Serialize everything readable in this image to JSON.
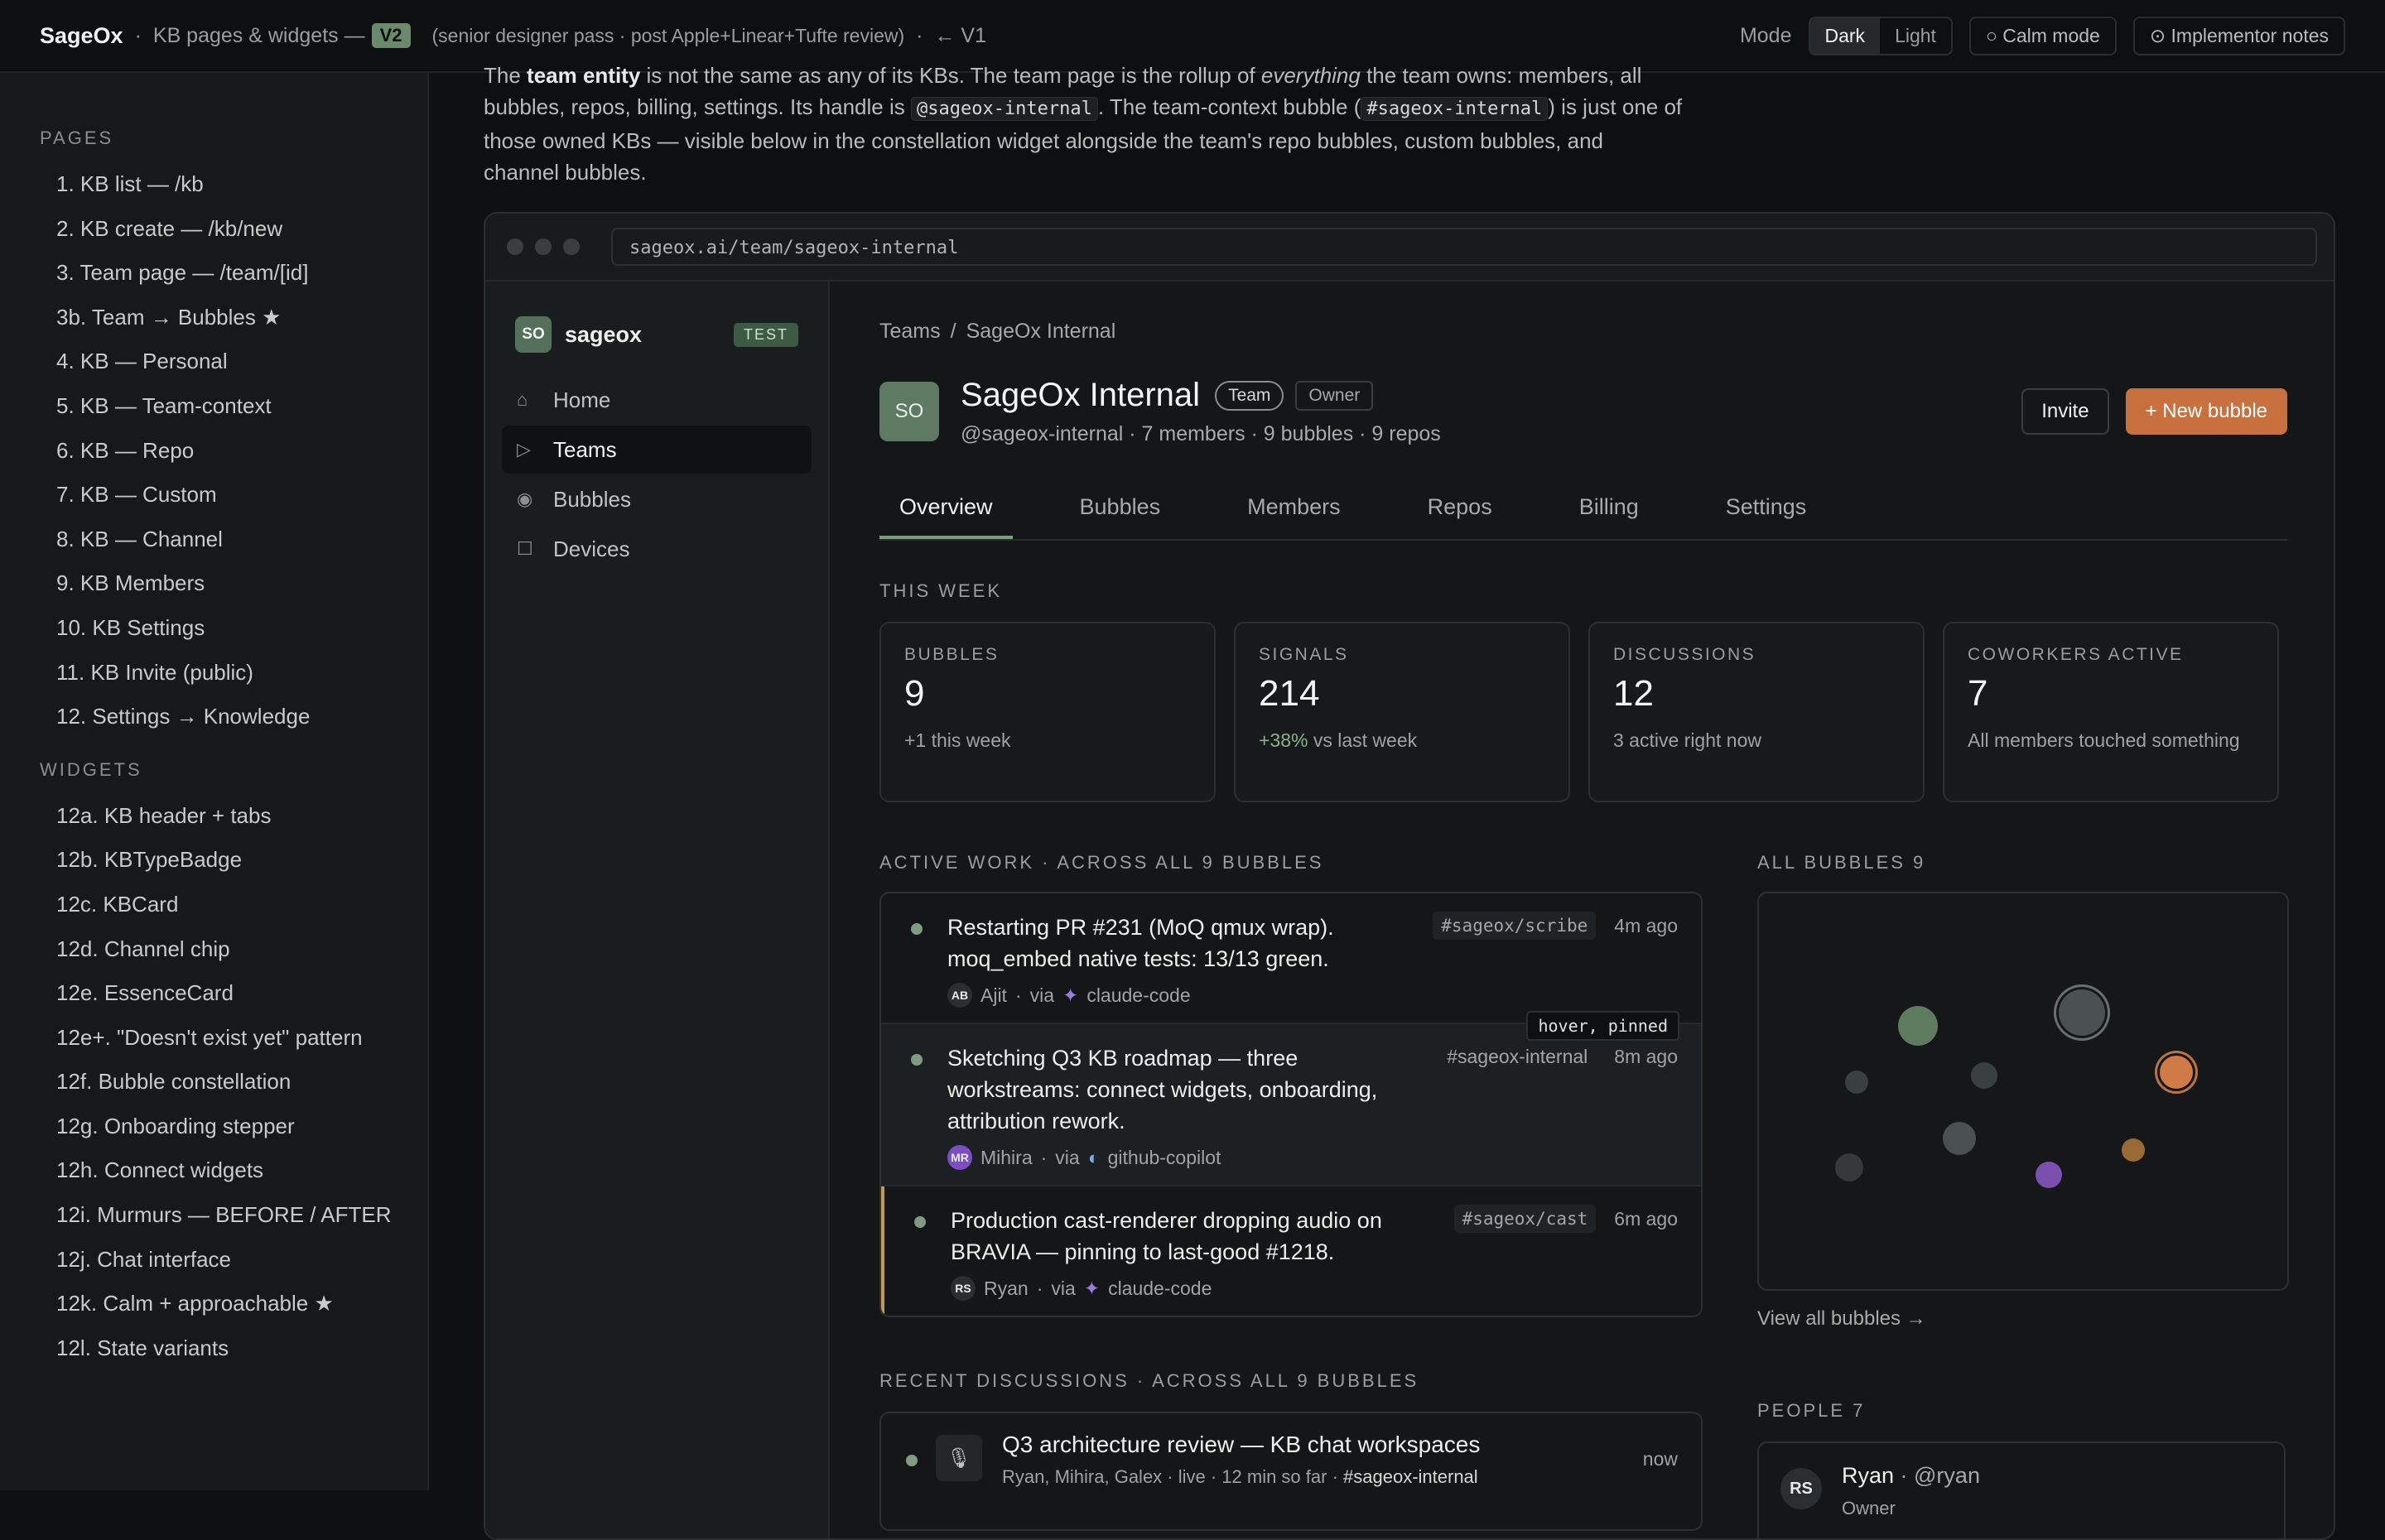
{
  "topbar": {
    "brand": "SageOx",
    "separator": "·",
    "section": "KB pages & widgets —",
    "version": "V2",
    "subtitle": "(senior designer pass · post Apple+Linear+Tufte review)",
    "back_link": "← V1",
    "mode_label": "Mode",
    "mode_dark": "Dark",
    "mode_light": "Light",
    "calm_mode": "Calm mode",
    "implementor_notes": "Implementor notes"
  },
  "leftnav": {
    "pages_heading": "PAGES",
    "pages": [
      "1. KB list — /kb",
      "2. KB create — /kb/new",
      "3. Team page — /team/[id]",
      "3b. Team → Bubbles ★",
      "4. KB — Personal",
      "5. KB — Team-context",
      "6. KB — Repo",
      "7. KB — Custom",
      "8. KB — Channel",
      "9. KB Members",
      "10. KB Settings",
      "11. KB Invite (public)",
      "12. Settings → Knowledge"
    ],
    "widgets_heading": "WIDGETS",
    "widgets": [
      "12a. KB header + tabs",
      "12b. KBTypeBadge",
      "12c. KBCard",
      "12d. Channel chip",
      "12e. EssenceCard",
      "12e+. \"Doesn't exist yet\" pattern",
      "12f. Bubble constellation",
      "12g. Onboarding stepper",
      "12h. Connect widgets",
      "12i. Murmurs — BEFORE / AFTER",
      "12j. Chat interface",
      "12k. Calm + approachable ★",
      "12l. State variants"
    ]
  },
  "intro": {
    "p1": "The ",
    "team_entity": "team entity",
    "p2": " is not the same as any of its KBs. The team page is the rollup of ",
    "everything": "everything",
    "p3": " the team owns: members, all bubbles, repos, billing, settings. Its handle is ",
    "handle": "@sageox-internal",
    "p4": ". The team-context bubble (",
    "bubble": "#sageox-internal",
    "p5": ") is just one of those owned KBs — visible below in the constellation widget alongside the team's repo bubbles, custom bubbles, and channel bubbles."
  },
  "browser": {
    "url": "sageox.ai/team/sageox-internal"
  },
  "app": {
    "workspace_initials": "SO",
    "workspace_name": "sageox",
    "env_badge": "TEST",
    "nav": [
      {
        "icon": "⌂",
        "label": "Home"
      },
      {
        "icon": "▷",
        "label": "Teams"
      },
      {
        "icon": "◉",
        "label": "Bubbles"
      },
      {
        "icon": "☐",
        "label": "Devices"
      }
    ]
  },
  "team": {
    "crumb_root": "Teams",
    "crumb_sep": "/",
    "crumb_current": "SageOx Internal",
    "initials": "SO",
    "name": "SageOx Internal",
    "type_pill": "Team",
    "role_tag": "Owner",
    "meta": "@sageox-internal · 7 members · 9 bubbles · 9 repos",
    "invite": "Invite",
    "new_bubble": "+ New bubble",
    "tabs": [
      "Overview",
      "Bubbles",
      "Members",
      "Repos",
      "Billing",
      "Settings"
    ]
  },
  "this_week": {
    "heading": "THIS WEEK",
    "stats": [
      {
        "label": "BUBBLES",
        "value": "9",
        "desc": "+1 this week",
        "desc_pos": ""
      },
      {
        "label": "SIGNALS",
        "value": "214",
        "desc_pos": "+38%",
        "desc": " vs last week"
      },
      {
        "label": "DISCUSSIONS",
        "value": "12",
        "desc": "3 active right now",
        "desc_pos": ""
      },
      {
        "label": "COWORKERS ACTIVE",
        "value": "7",
        "desc": "All members touched something",
        "desc_pos": ""
      }
    ]
  },
  "active_work": {
    "heading": "ACTIVE WORK · ACROSS ALL 9 BUBBLES",
    "tooltip": "hover, pinned",
    "via": "via",
    "dot": "·",
    "items": [
      {
        "text": "Restarting PR #231 (MoQ qmux wrap). moq_embed native tests: 13/13 green.",
        "chip": "#sageox/scribe",
        "time": "4m ago",
        "initials": "AB",
        "person": "Ajit",
        "agent_icon": "✦",
        "agent": "claude-code"
      },
      {
        "text": "Sketching Q3 KB roadmap — three workstreams: connect widgets, onboarding, attribution rework.",
        "chip": "#sageox-internal",
        "time": "8m ago",
        "initials": "MR",
        "person": "Mihira",
        "agent_icon": "◐",
        "agent": "github-copilot"
      },
      {
        "text": "Production cast-renderer dropping audio on BRAVIA — pinning to last-good #1218.",
        "chip": "#sageox/cast",
        "time": "6m ago",
        "initials": "RS",
        "person": "Ryan",
        "agent_icon": "✦",
        "agent": "claude-code"
      }
    ]
  },
  "all_bubbles": {
    "heading": "ALL BUBBLES 9",
    "view_all": "View all bubbles →",
    "colors": {
      "sage": "#6b8a6b",
      "orange": "#d07a45",
      "violet": "#8a5cc0",
      "amber": "#a8743a",
      "grey": "#464b4e"
    }
  },
  "recent": {
    "heading": "RECENT DISCUSSIONS · ACROSS ALL 9 BUBBLES",
    "icon": "🎙",
    "title": "Q3 architecture review — KB chat workspaces",
    "meta": "Ryan, Mihira, Galex · live · 12 min so far · ",
    "channel": "#sageox-internal",
    "time": "now"
  },
  "people": {
    "heading": "PEOPLE 7",
    "first": {
      "initials": "RS",
      "name": "Ryan",
      "handle": " · @ryan",
      "role": "Owner"
    }
  }
}
